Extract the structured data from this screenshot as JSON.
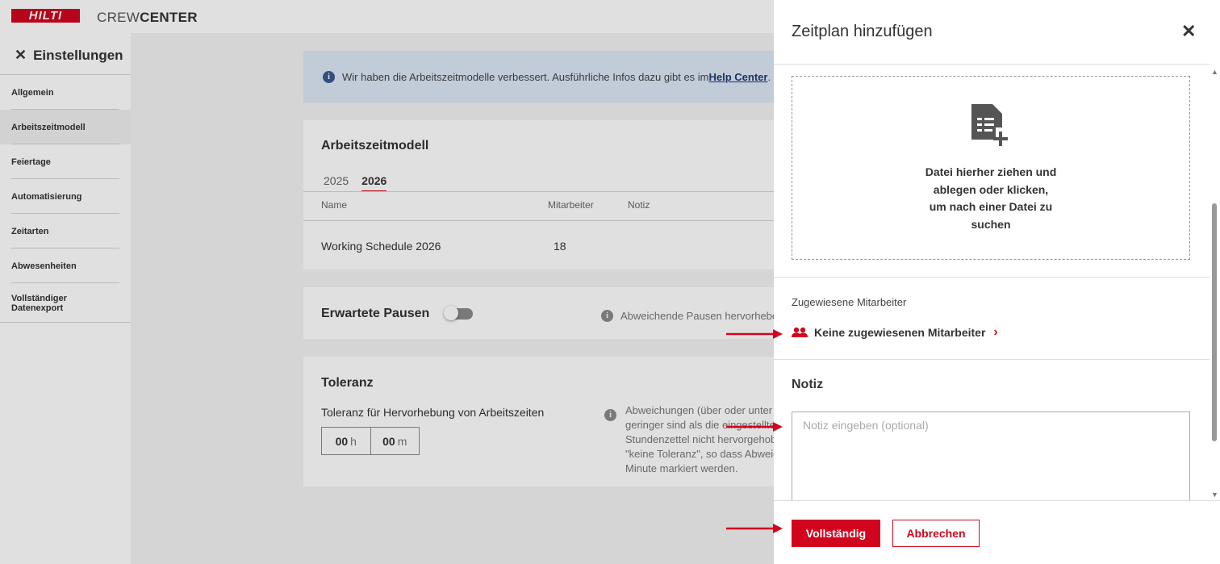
{
  "header": {
    "logo_text": "HILTI",
    "app_name_light": "CREW",
    "app_name_bold": "CENTER"
  },
  "sidebar": {
    "close_glyph": "✕",
    "title": "Einstellungen",
    "items": [
      {
        "label": "Allgemein"
      },
      {
        "label": "Arbeitszeitmodell"
      },
      {
        "label": "Feiertage"
      },
      {
        "label": "Automatisierung"
      },
      {
        "label": "Zeitarten"
      },
      {
        "label": "Abwesenheiten"
      },
      {
        "label": "Vollständiger\nDatenexport"
      }
    ]
  },
  "info_banner": {
    "text": "Wir haben die Arbeitszeitmodelle verbessert. Ausführliche Infos dazu gibt es im",
    "link": "Help Center",
    "trail": "."
  },
  "schedule_card": {
    "title": "Arbeitszeitmodell",
    "tabs": [
      "2025",
      "2026"
    ],
    "columns": [
      "Name",
      "Mitarbeiter",
      "Notiz"
    ],
    "rows": [
      {
        "name": "Working Schedule 2026",
        "employees": "18",
        "note": ""
      }
    ]
  },
  "breaks_card": {
    "title": "Erwartete Pausen",
    "hint": "Abweichende Pausen hervorhebe"
  },
  "tolerance_card": {
    "title": "Toleranz",
    "label": "Toleranz für Hervorhebung von Arbeitszeiten",
    "hours": "00",
    "hours_unit": "h",
    "minutes": "00",
    "minutes_unit": "m",
    "hint": "Abweichungen (über oder unter d\ngeringer sind als die eingestellte\nStundenzettel nicht hervorgehob\n\"keine Toleranz\", so dass Abweic\nMinute markiert werden."
  },
  "drawer": {
    "title": "Zeitplan hinzufügen",
    "close_glyph": "✕",
    "dropzone_text": "Datei hierher ziehen und\nablegen oder klicken,\num nach einer Datei zu\nsuchen",
    "assigned_label": "Zugewiesene Mitarbeiter",
    "assigned_link": "Keine zugewiesenen Mitarbeiter",
    "chevron": "›",
    "note_title": "Notiz",
    "note_placeholder": "Notiz eingeben (optional)",
    "note_value": "",
    "primary_button": "Vollständig",
    "secondary_button": "Abbrechen"
  },
  "colors": {
    "brand": "#d2051e",
    "info_bg": "#dde8f6",
    "overlay": "rgba(0,0,0,0.12)"
  },
  "icons": [
    "close-icon",
    "info-icon",
    "document-add-icon",
    "people-icon",
    "chevron-right-icon",
    "arrow-annotation"
  ]
}
